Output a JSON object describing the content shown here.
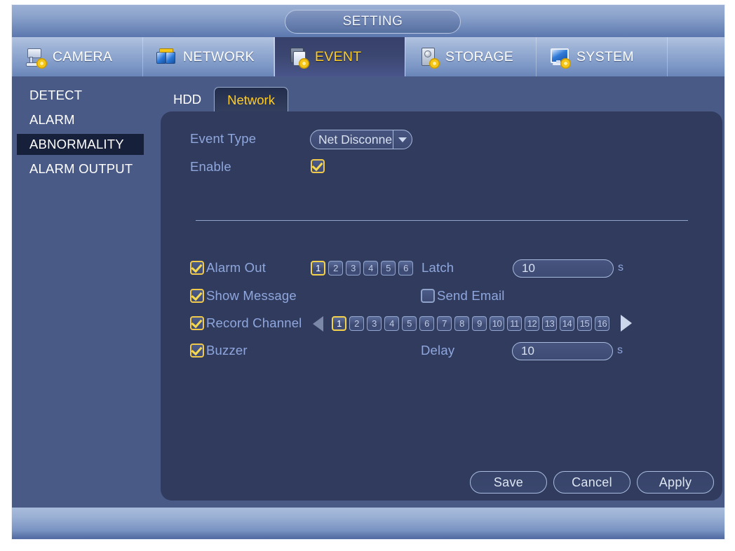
{
  "window": {
    "title": "SETTING"
  },
  "main_tabs": [
    {
      "label": "CAMERA",
      "icon": "camera-gear-icon",
      "active": false
    },
    {
      "label": "NETWORK",
      "icon": "network-icon",
      "active": false
    },
    {
      "label": "EVENT",
      "icon": "event-gear-icon",
      "active": true
    },
    {
      "label": "STORAGE",
      "icon": "hdd-gear-icon",
      "active": false
    },
    {
      "label": "SYSTEM",
      "icon": "monitor-gear-icon",
      "active": false
    }
  ],
  "sidebar": {
    "items": [
      {
        "label": "DETECT",
        "active": false
      },
      {
        "label": "ALARM",
        "active": false
      },
      {
        "label": "ABNORMALITY",
        "active": true
      },
      {
        "label": "ALARM OUTPUT",
        "active": false
      }
    ]
  },
  "sub_tabs": [
    {
      "label": "HDD",
      "active": false
    },
    {
      "label": "Network",
      "active": true
    }
  ],
  "form": {
    "event_type_label": "Event Type",
    "event_type_value": "Net Disconne",
    "event_type_options": [
      "Net Disconne"
    ],
    "enable_label": "Enable",
    "enable_checked": true,
    "alarm_out_label": "Alarm Out",
    "alarm_out_checked": true,
    "alarm_out_channels": [
      "1",
      "2",
      "3",
      "4",
      "5",
      "6"
    ],
    "alarm_out_selected": [
      "1"
    ],
    "latch_label": "Latch",
    "latch_value": "10",
    "latch_unit": "s",
    "show_message_label": "Show Message",
    "show_message_checked": true,
    "send_email_label": "Send Email",
    "send_email_checked": false,
    "record_channel_label": "Record Channel",
    "record_channel_checked": true,
    "record_channels": [
      "1",
      "2",
      "3",
      "4",
      "5",
      "6",
      "7",
      "8",
      "9",
      "10",
      "11",
      "12",
      "13",
      "14",
      "15",
      "16"
    ],
    "record_channel_selected": [
      "1"
    ],
    "page_prev_icon": "triangle-left-icon",
    "page_next_icon": "triangle-right-icon",
    "buzzer_label": "Buzzer",
    "buzzer_checked": true,
    "delay_label": "Delay",
    "delay_value": "10",
    "delay_unit": "s"
  },
  "buttons": {
    "save": "Save",
    "cancel": "Cancel",
    "apply": "Apply"
  },
  "colors": {
    "accent_yellow": "#ffcc22",
    "panel_bg": "#303b5e",
    "body_bg": "#4a5a86",
    "label_blue": "#8fa7dd",
    "highlight_dark": "#17203a"
  }
}
